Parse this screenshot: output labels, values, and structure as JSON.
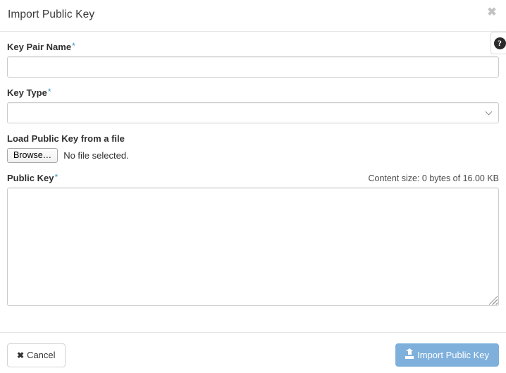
{
  "dialog": {
    "title": "Import Public Key",
    "close_icon": "close-icon",
    "close_glyph": "✖"
  },
  "help": {
    "icon": "help-question-icon",
    "glyph": "?"
  },
  "form": {
    "key_pair_name": {
      "label": "Key Pair Name",
      "required_marker": "*",
      "value": "",
      "placeholder": ""
    },
    "key_type": {
      "label": "Key Type",
      "required_marker": "*",
      "selected": "",
      "options": [
        ""
      ],
      "chevron_icon": "chevron-down-icon"
    },
    "load_from_file": {
      "label": "Load Public Key from a file",
      "browse_label": "Browse…",
      "file_status": "No file selected."
    },
    "public_key": {
      "label": "Public Key",
      "required_marker": "*",
      "content_size": "Content size: 0 bytes of 16.00 KB",
      "value": "",
      "placeholder": "",
      "resize_handle_icon": "resize-grip-icon"
    }
  },
  "footer": {
    "cancel_label": "Cancel",
    "cancel_glyph": "✖",
    "submit_label": "Import Public Key",
    "submit_icon": "upload-icon"
  },
  "colors": {
    "required_asterisk": "#3c8dbc",
    "primary_button": "#7fb0dc",
    "border": "#cccccc",
    "divider": "#e5e5e5",
    "text": "#333333"
  }
}
